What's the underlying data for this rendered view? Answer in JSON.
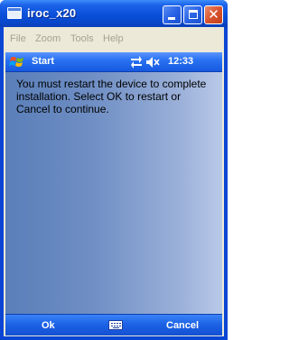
{
  "window": {
    "title": "iroc_x20",
    "app_icon": "window-icon",
    "buttons": {
      "minimize_icon": "minimize-icon",
      "maximize_icon": "maximize-icon",
      "close_icon": "close-icon"
    }
  },
  "menubar": {
    "items": [
      {
        "label": "File"
      },
      {
        "label": "Zoom"
      },
      {
        "label": "Tools"
      },
      {
        "label": "Help"
      }
    ]
  },
  "device": {
    "navbar": {
      "start_label": "Start",
      "start_icon": "windows-flag-icon",
      "connectivity_icon": "connectivity-arrows-icon",
      "volume_icon": "speaker-muted-icon",
      "time": "12:33"
    },
    "message": "You must restart the device to complete installation. Select OK to restart or Cancel to continue.",
    "softkeys": {
      "left": "Ok",
      "center_icon": "keyboard-icon",
      "right": "Cancel"
    }
  },
  "colors": {
    "titlebar_blue": "#0a4fd9",
    "navbar_blue": "#2a72f2",
    "menu_disabled_text": "#a7a293",
    "close_red": "#d9542e"
  }
}
